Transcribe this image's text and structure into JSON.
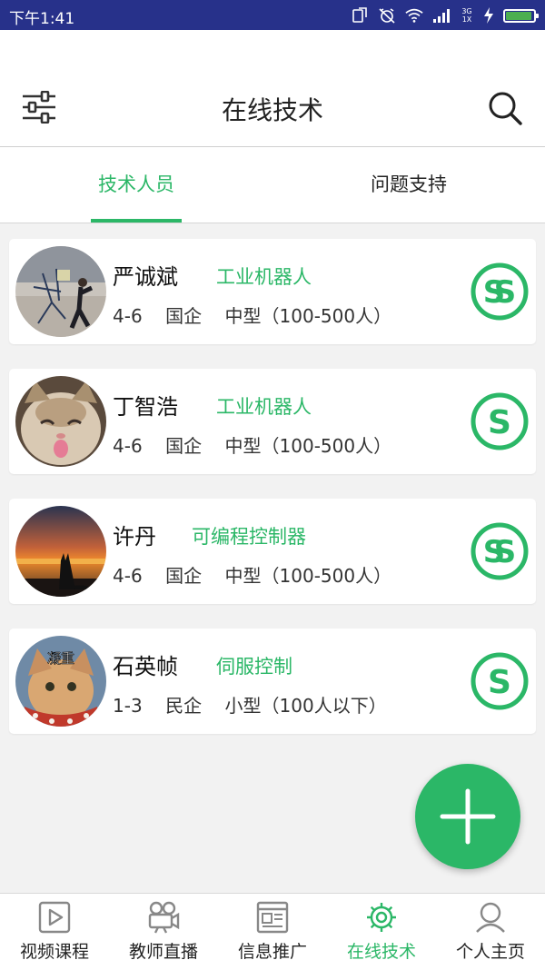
{
  "status_bar": {
    "time": "下午1:41",
    "network_top": "3G",
    "network_bottom": "1X",
    "battery_level": 1.0
  },
  "header": {
    "title": "在线技术",
    "left_icon": "sliders-icon",
    "right_icon": "search-icon"
  },
  "tabs": [
    {
      "label": "技术人员",
      "active": true
    },
    {
      "label": "问题支持",
      "active": false
    }
  ],
  "list": [
    {
      "name": "严诚斌",
      "field": "工业机器人",
      "meta": "4-6    国企    中型（100-500人）",
      "badge_icon": "double-s-icon"
    },
    {
      "name": "丁智浩",
      "field": "工业机器人",
      "meta": "4-6    国企    中型（100-500人）",
      "badge_icon": "s-icon"
    },
    {
      "name": "许丹",
      "field": "可编程控制器",
      "meta": "4-6    国企    中型（100-500人）",
      "badge_icon": "double-s-icon"
    },
    {
      "name": "石英帧",
      "field": "伺服控制",
      "meta": "1-3    民企    小型（100人以下）",
      "badge_icon": "s-icon",
      "avatar_caption": "凝重"
    }
  ],
  "fab": {
    "icon": "plus-icon"
  },
  "bottom_nav": [
    {
      "label": "视频课程",
      "icon": "video-icon",
      "active": false
    },
    {
      "label": "教师直播",
      "icon": "camera-icon",
      "active": false
    },
    {
      "label": "信息推广",
      "icon": "news-icon",
      "active": false
    },
    {
      "label": "在线技术",
      "icon": "gear-icon",
      "active": true
    },
    {
      "label": "个人主页",
      "icon": "user-icon",
      "active": false
    }
  ],
  "colors": {
    "accent": "#2bb767",
    "status_bar": "#27318a",
    "background": "#f2f2f2"
  }
}
